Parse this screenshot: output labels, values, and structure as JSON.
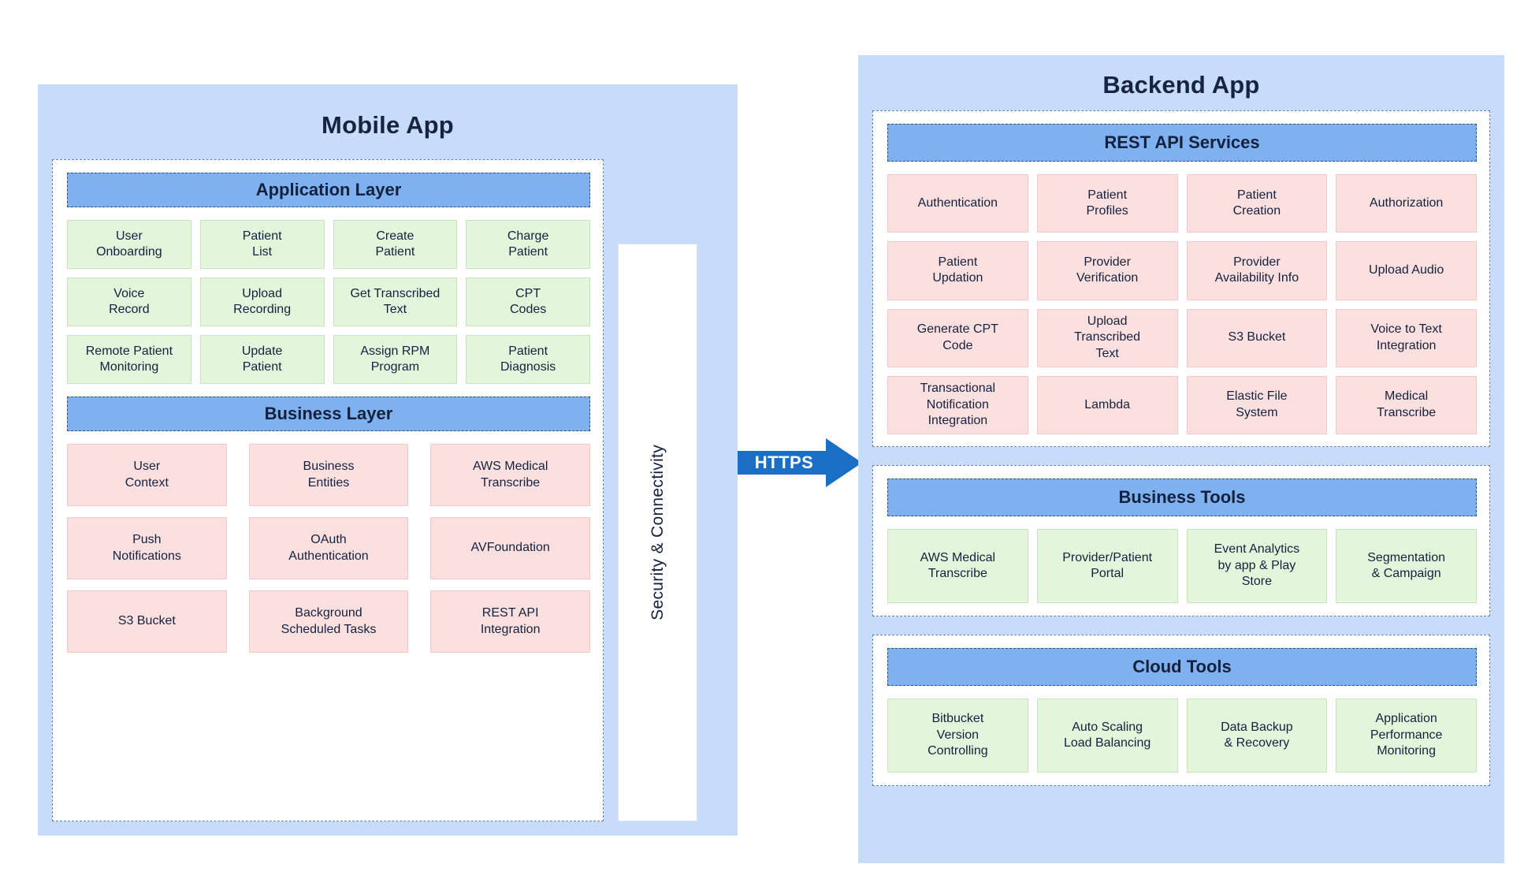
{
  "diagram": {
    "type": "architecture-diagram",
    "colors": {
      "panel_background": "#c7dcfb",
      "section_background": "#ffffff",
      "header_bar": "#7fb0f0",
      "green_tile": "#e3f6dc",
      "pink_tile": "#fce0e0",
      "arrow": "#1a6fc4",
      "text": "#14213d"
    }
  },
  "mobile_app": {
    "title": "Mobile App",
    "application_layer": {
      "header": "Application Layer",
      "tiles": [
        "User\nOnboarding",
        "Patient\nList",
        "Create\nPatient",
        "Charge\nPatient",
        "Voice\nRecord",
        "Upload\nRecording",
        "Get Transcribed\nText",
        "CPT\nCodes",
        "Remote Patient\nMonitoring",
        "Update\nPatient",
        "Assign RPM\nProgram",
        "Patient\nDiagnosis"
      ]
    },
    "business_layer": {
      "header": "Business Layer",
      "tiles": [
        "User\nContext",
        "Business\nEntities",
        "AWS Medical\nTranscribe",
        "Push\nNotifications",
        "OAuth\nAuthentication",
        "AVFoundation",
        "S3 Bucket",
        "Background\nScheduled Tasks",
        "REST API\nIntegration"
      ]
    }
  },
  "security_strip": {
    "label": "Security & Connectivity"
  },
  "connector": {
    "label": "HTTPS"
  },
  "backend_app": {
    "title": "Backend App",
    "rest_api_services": {
      "header": "REST API Services",
      "tiles": [
        "Authentication",
        "Patient\nProfiles",
        "Patient\nCreation",
        "Authorization",
        "Patient\nUpdation",
        "Provider\nVerification",
        "Provider\nAvailability Info",
        "Upload Audio",
        "Generate CPT\nCode",
        "Upload\nTranscribed\nText",
        "S3 Bucket",
        "Voice to Text\nIntegration",
        "Transactional\nNotification\nIntegration",
        "Lambda",
        "Elastic File\nSystem",
        "Medical\nTranscribe"
      ]
    },
    "business_tools": {
      "header": "Business Tools",
      "tiles": [
        "AWS Medical\nTranscribe",
        "Provider/Patient\nPortal",
        "Event Analytics\nby app & Play\nStore",
        "Segmentation\n& Campaign"
      ]
    },
    "cloud_tools": {
      "header": "Cloud Tools",
      "tiles": [
        "Bitbucket\nVersion\nControlling",
        "Auto Scaling\nLoad Balancing",
        "Data Backup\n& Recovery",
        "Application\nPerformance\nMonitoring"
      ]
    }
  }
}
